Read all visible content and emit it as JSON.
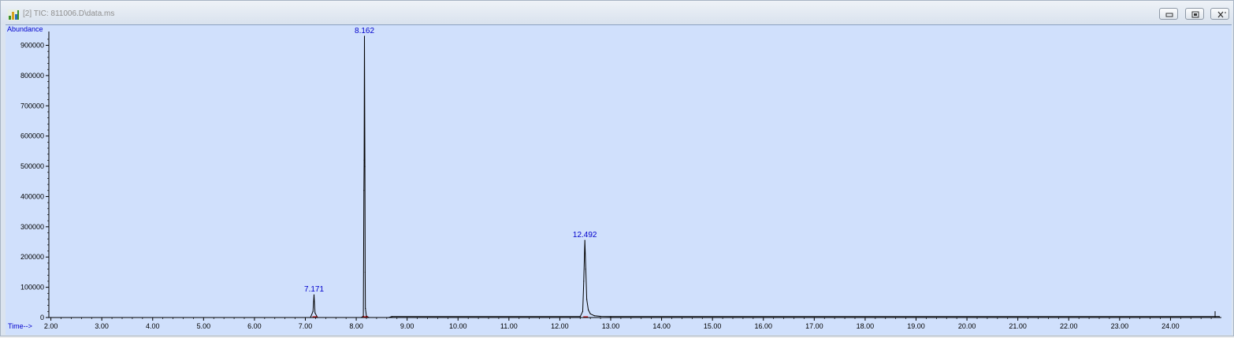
{
  "window": {
    "title": "[2] TIC: 811006.D\\data.ms",
    "buttons": [
      "minimize",
      "restore",
      "close"
    ]
  },
  "icons": {
    "app": "chromatogram-app-icon",
    "minimize": "minimize-icon",
    "restore": "restore-icon",
    "close": "close-icon"
  },
  "colors": {
    "plot_background": "#d0e0fc",
    "trace": "#000000",
    "peak_label": "#0000cc",
    "axis_label": "#0000cc",
    "baseline_marker": "#cc0000"
  },
  "chart_data": {
    "type": "line",
    "title": "",
    "ylabel": "Abundance",
    "xlabel": "Time-->",
    "xlim": [
      1.96,
      25.0
    ],
    "ylim": [
      0,
      930000
    ],
    "x_ticks": [
      "2.00",
      "3.00",
      "4.00",
      "5.00",
      "6.00",
      "7.00",
      "8.00",
      "9.00",
      "10.00",
      "11.00",
      "12.00",
      "13.00",
      "14.00",
      "15.00",
      "16.00",
      "17.00",
      "18.00",
      "19.00",
      "20.00",
      "21.00",
      "22.00",
      "23.00",
      "24.00"
    ],
    "y_ticks": [
      "0",
      "100000",
      "200000",
      "300000",
      "400000",
      "500000",
      "600000",
      "700000",
      "800000",
      "900000"
    ],
    "grid": false,
    "legend": "none",
    "series": [
      {
        "x": [
          1.96,
          7.1,
          7.15,
          7.171,
          7.19,
          7.24,
          8.1,
          8.14,
          8.15,
          8.155,
          8.162,
          8.17,
          8.175,
          8.18,
          8.2,
          8.25,
          8.64,
          8.7,
          12.4,
          12.45,
          12.47,
          12.492,
          12.51,
          12.53,
          12.56,
          12.6,
          12.68,
          12.8,
          13.0,
          24.96
        ],
        "y": [
          0,
          0,
          20000,
          75000,
          15000,
          0,
          0,
          5000,
          420000,
          520000,
          930000,
          500000,
          150000,
          30000,
          5000,
          0,
          0,
          3000,
          3000,
          20000,
          120000,
          255000,
          160000,
          60000,
          25000,
          12000,
          6000,
          4000,
          3000,
          3000
        ]
      }
    ],
    "peak_labels": [
      {
        "x": 7.171,
        "y": 75000,
        "text": "7.171"
      },
      {
        "x": 8.162,
        "y": 930000,
        "text": "8.162"
      },
      {
        "x": 12.492,
        "y": 255000,
        "text": "12.492"
      }
    ]
  }
}
